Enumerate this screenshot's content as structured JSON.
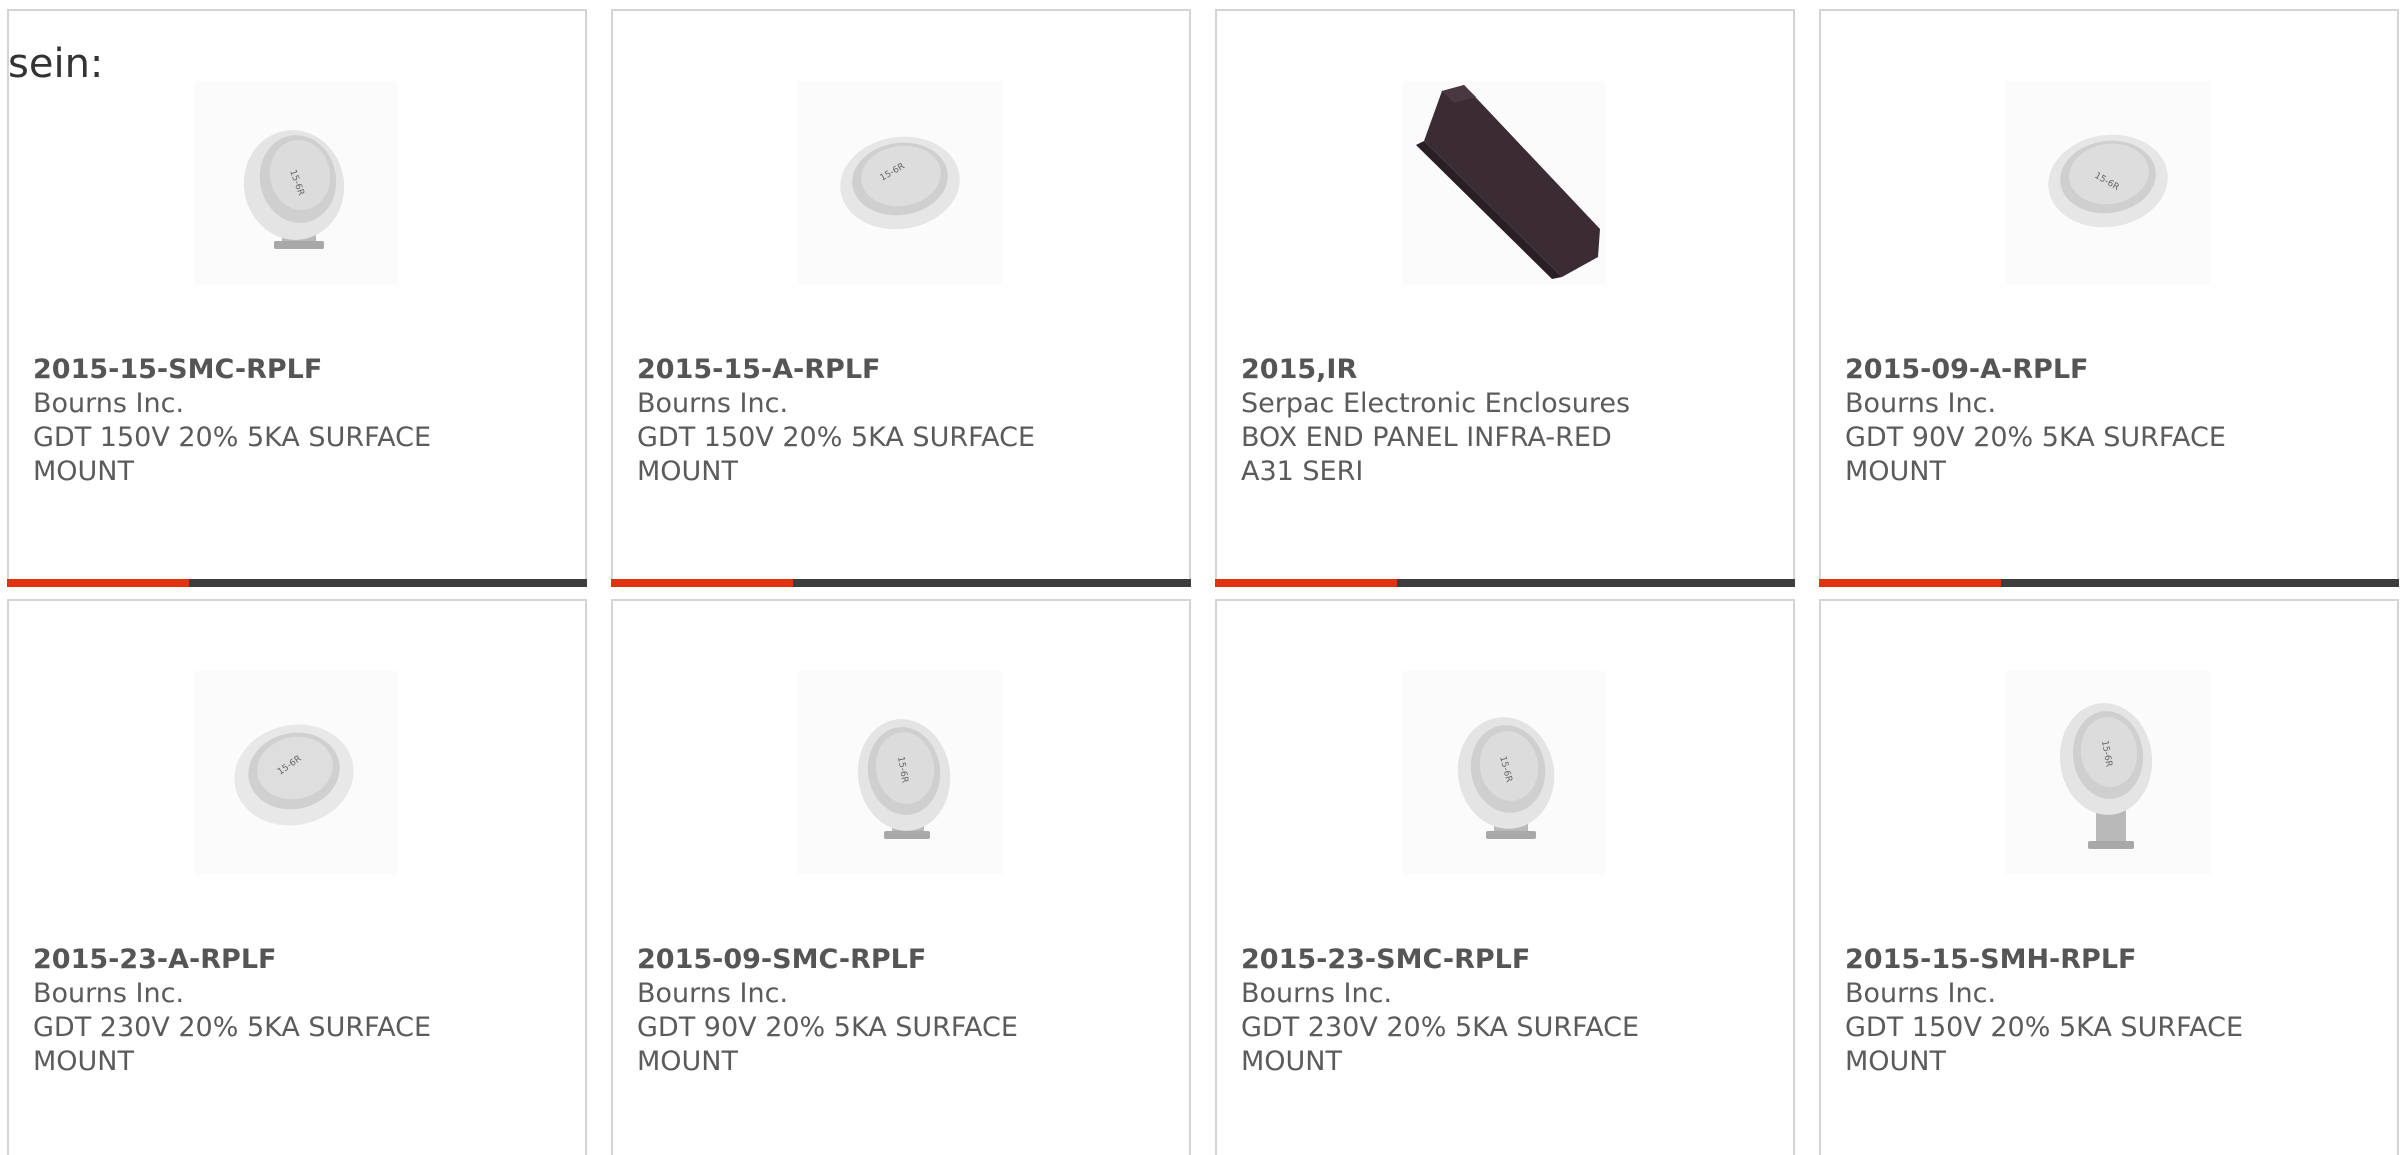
{
  "lead_text": "sein:",
  "colors": {
    "accent": "#e13310",
    "bar": "#3d3d3d",
    "border": "#d4d4d4",
    "text": "#5b5b5b"
  },
  "products": [
    {
      "part_number": "2015-15-SMC-RPLF",
      "manufacturer": "Bourns Inc.",
      "description": "GDT 150V 20% 5KA SURFACE MOUNT",
      "image": "gas-discharge-tube-smc-icon"
    },
    {
      "part_number": "2015-15-A-RPLF",
      "manufacturer": "Bourns Inc.",
      "description": "GDT 150V 20% 5KA SURFACE MOUNT",
      "image": "gas-discharge-tube-flat-icon"
    },
    {
      "part_number": "2015,IR",
      "manufacturer": "Serpac Electronic Enclosures",
      "description": "BOX END PANEL INFRA-RED A31 SERI",
      "image": "infrared-end-panel-icon"
    },
    {
      "part_number": "2015-09-A-RPLF",
      "manufacturer": "Bourns Inc.",
      "description": "GDT 90V 20% 5KA SURFACE MOUNT",
      "image": "gas-discharge-tube-flat-icon"
    },
    {
      "part_number": "2015-23-A-RPLF",
      "manufacturer": "Bourns Inc.",
      "description": "GDT 230V 20% 5KA SURFACE MOUNT",
      "image": "gas-discharge-tube-flat-icon"
    },
    {
      "part_number": "2015-09-SMC-RPLF",
      "manufacturer": "Bourns Inc.",
      "description": "GDT 90V 20% 5KA SURFACE MOUNT",
      "image": "gas-discharge-tube-smc-icon"
    },
    {
      "part_number": "2015-23-SMC-RPLF",
      "manufacturer": "Bourns Inc.",
      "description": "GDT 230V 20% 5KA SURFACE MOUNT",
      "image": "gas-discharge-tube-smc-icon"
    },
    {
      "part_number": "2015-15-SMH-RPLF",
      "manufacturer": "Bourns Inc.",
      "description": "GDT 150V 20% 5KA SURFACE MOUNT",
      "image": "gas-discharge-tube-smh-icon"
    }
  ]
}
